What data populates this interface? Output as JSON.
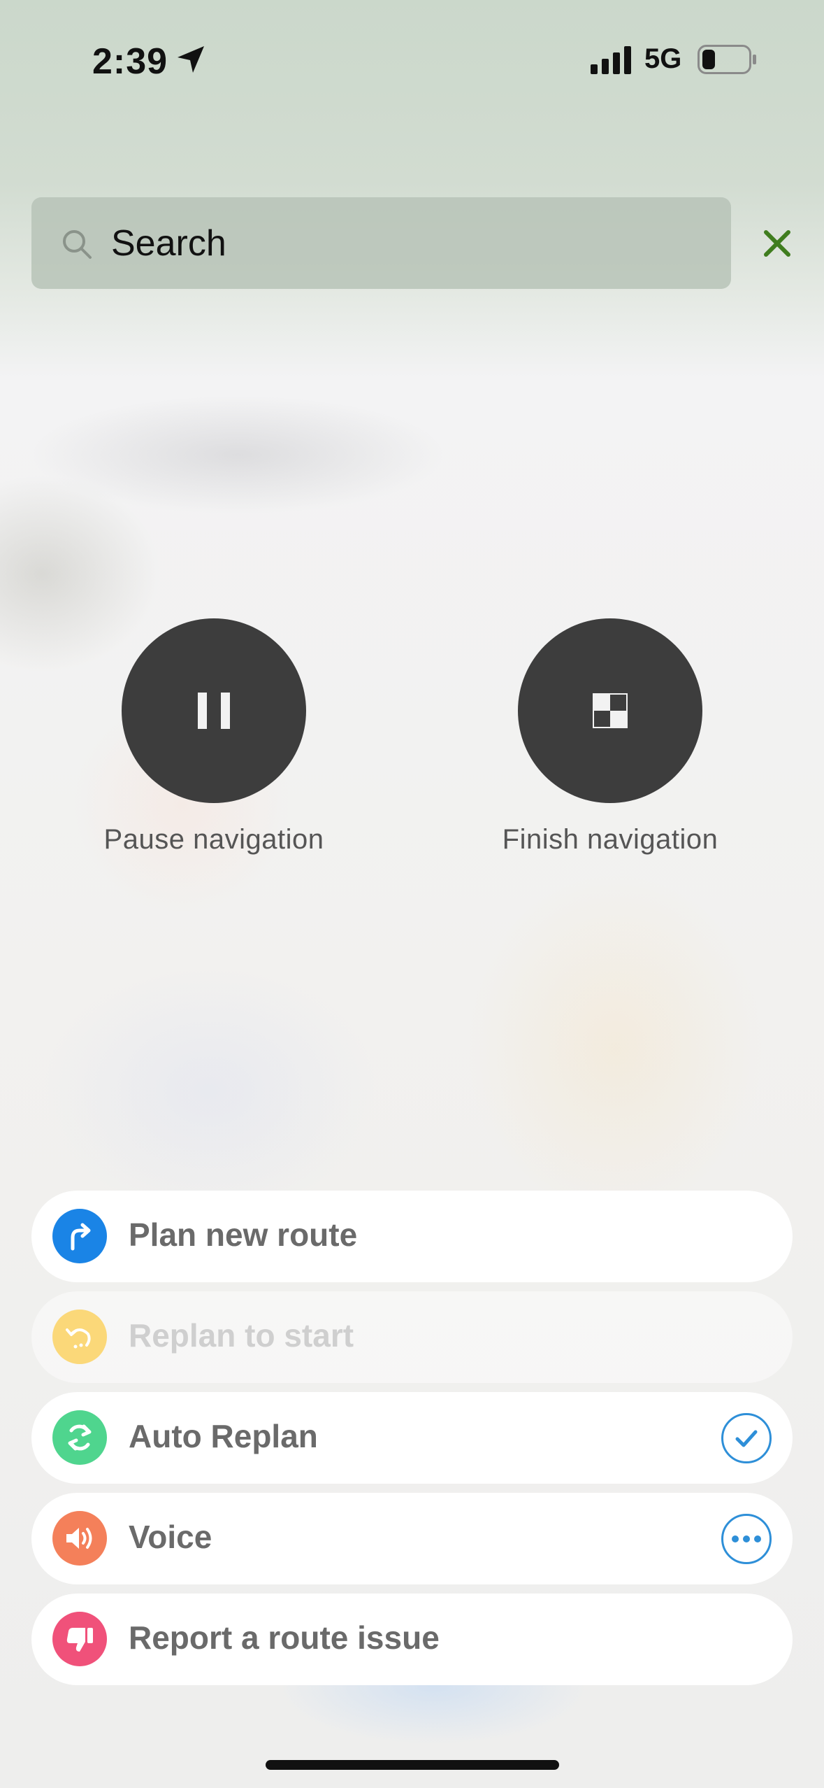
{
  "status_bar": {
    "time": "2:39",
    "network": "5G",
    "battery_level": 0.2
  },
  "search": {
    "placeholder": "Search"
  },
  "navigation": {
    "pause_label": "Pause navigation",
    "finish_label": "Finish navigation"
  },
  "actions": [
    {
      "label": "Plan new route",
      "icon": "turn-right-icon",
      "color": "#1a84e6",
      "enabled": true
    },
    {
      "label": "Replan to start",
      "icon": "replan-back-icon",
      "color": "#fbd879",
      "enabled": false
    },
    {
      "label": "Auto Replan",
      "icon": "refresh-icon",
      "color": "#4fd58e",
      "enabled": true,
      "checked": true
    },
    {
      "label": "Voice",
      "icon": "speaker-icon",
      "color": "#f4805a",
      "enabled": true
    },
    {
      "label": "Report a route issue",
      "icon": "thumbs-down-icon",
      "color": "#f0517a",
      "enabled": true
    }
  ],
  "colors": {
    "accent": "#2e8fd8",
    "close": "#3f7d1e",
    "nav_button": "#3d3d3d"
  }
}
